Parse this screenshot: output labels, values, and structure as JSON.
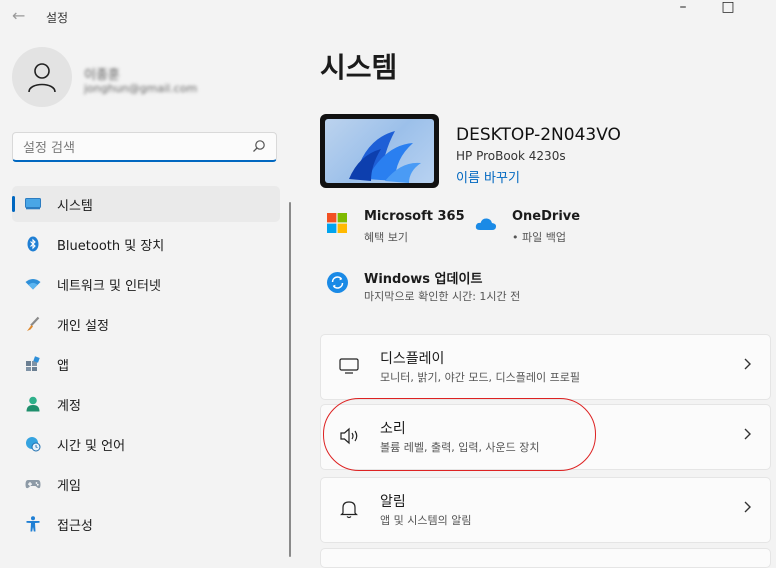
{
  "titlebar": {
    "back_glyph": "←",
    "title": "설정",
    "minimize": "–",
    "maximize": "□"
  },
  "user": {
    "name": "이종훈",
    "email": "jonghun@gmail.com"
  },
  "search": {
    "placeholder": "설정 검색"
  },
  "nav": {
    "items": [
      {
        "label": "시스템",
        "icon": "system-icon",
        "active": true
      },
      {
        "label": "Bluetooth 및 장치",
        "icon": "bluetooth-icon"
      },
      {
        "label": "네트워크 및 인터넷",
        "icon": "wifi-icon"
      },
      {
        "label": "개인 설정",
        "icon": "brush-icon"
      },
      {
        "label": "앱",
        "icon": "apps-icon"
      },
      {
        "label": "계정",
        "icon": "account-icon"
      },
      {
        "label": "시간 및 언어",
        "icon": "globe-clock-icon"
      },
      {
        "label": "게임",
        "icon": "gamepad-icon"
      },
      {
        "label": "접근성",
        "icon": "accessibility-icon"
      }
    ]
  },
  "main": {
    "title": "시스템",
    "device": {
      "name": "DESKTOP-2N043VO",
      "model": "HP ProBook 4230s",
      "rename": "이름 바꾸기"
    },
    "quick": [
      {
        "title": "Microsoft 365",
        "sub": "혜택 보기",
        "icon": "microsoft-logo-icon"
      },
      {
        "title": "OneDrive",
        "sub": "• 파일 백업",
        "icon": "onedrive-icon"
      },
      {
        "title": "Windows 업데이트",
        "sub": "마지막으로 확인한 시간: 1시간 전",
        "icon": "windows-update-icon"
      }
    ],
    "cards": [
      {
        "title": "디스플레이",
        "sub": "모니터, 밝기, 야간 모드, 디스플레이 프로필",
        "icon": "display-icon"
      },
      {
        "title": "소리",
        "sub": "볼륨 레벨, 출력, 입력, 사운드 장치",
        "icon": "speaker-icon"
      },
      {
        "title": "알림",
        "sub": "앱 및 시스템의 알림",
        "icon": "bell-icon"
      }
    ]
  },
  "colors": {
    "accent": "#0067c0",
    "highlight": "#dd2222"
  }
}
